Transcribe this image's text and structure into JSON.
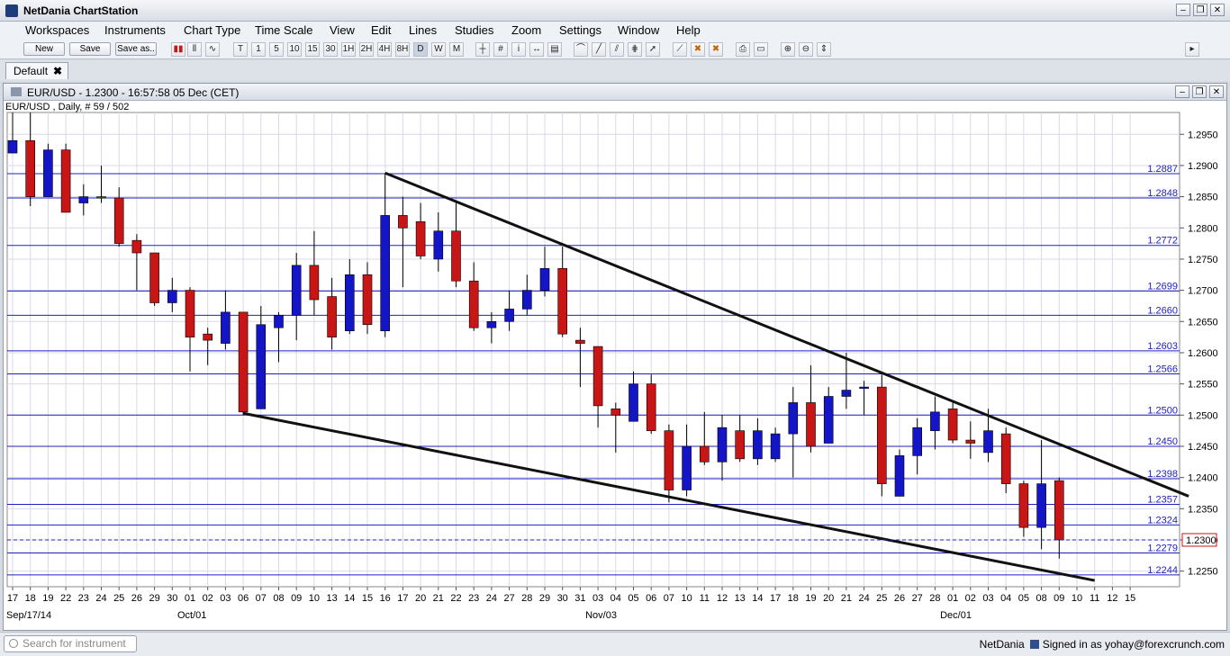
{
  "app": {
    "title": "NetDania ChartStation"
  },
  "menu": [
    "Workspaces",
    "Instruments",
    "Chart Type",
    "Time Scale",
    "View",
    "Edit",
    "Lines",
    "Studies",
    "Zoom",
    "Settings",
    "Window",
    "Help"
  ],
  "toolbar": {
    "new_label": "New",
    "save_label": "Save",
    "save_as_label": "Save as..",
    "timeframes": [
      "T",
      "1",
      "5",
      "10",
      "15",
      "30",
      "1H",
      "2H",
      "4H",
      "8H",
      "D",
      "W",
      "M"
    ]
  },
  "tabs": [
    {
      "label": "Default",
      "close": "✖"
    }
  ],
  "chart_window": {
    "title": "EUR/USD - 1.2300 - 16:57:58  05 Dec (CET)",
    "subtitle": "EUR/USD , Daily, # 59 / 502"
  },
  "statusbar": {
    "search_placeholder": "Search for instrument",
    "brand": "NetDania",
    "signed_in": "Signed in as yohay@forexcrunch.com"
  },
  "colors": {
    "up": "#1515c8",
    "down": "#c81515",
    "level": "#2020c0",
    "trend": "#111111",
    "grid": "#d8d8e8"
  },
  "chart_data": {
    "type": "candlestick",
    "symbol": "EUR/USD",
    "ylim": [
      1.2225,
      1.2985
    ],
    "yticks": [
      "1.2950",
      "1.2900",
      "1.2850",
      "1.2800",
      "1.2750",
      "1.2700",
      "1.2650",
      "1.2600",
      "1.2550",
      "1.2500",
      "1.2450",
      "1.2400",
      "1.2350",
      "1.2300",
      "1.2250"
    ],
    "dates": [
      "17",
      "18",
      "19",
      "22",
      "23",
      "24",
      "25",
      "26",
      "29",
      "30",
      "01",
      "02",
      "03",
      "06",
      "07",
      "08",
      "09",
      "10",
      "13",
      "14",
      "15",
      "16",
      "17",
      "20",
      "21",
      "22",
      "23",
      "24",
      "27",
      "28",
      "29",
      "30",
      "31",
      "03",
      "04",
      "05",
      "06",
      "07",
      "10",
      "11",
      "12",
      "13",
      "14",
      "17",
      "18",
      "19",
      "20",
      "21",
      "24",
      "25",
      "26",
      "27",
      "28",
      "01",
      "02",
      "03",
      "04",
      "05"
    ],
    "x_tick_labels": [
      "17",
      "18",
      "19",
      "22",
      "23",
      "24",
      "25",
      "26",
      "29",
      "30",
      "01",
      "02",
      "03",
      "06",
      "07",
      "08",
      "09",
      "10",
      "13",
      "14",
      "15",
      "16",
      "17",
      "20",
      "21",
      "22",
      "23",
      "24",
      "27",
      "28",
      "29",
      "30",
      "31",
      "03",
      "04",
      "05",
      "06",
      "07",
      "10",
      "11",
      "12",
      "13",
      "14",
      "17",
      "18",
      "19",
      "20",
      "21",
      "24",
      "25",
      "26",
      "27",
      "28",
      "01",
      "02",
      "03",
      "04",
      "05",
      "08",
      "09",
      "10",
      "11",
      "12",
      "15"
    ],
    "month_labels": [
      {
        "text": "Sep/17/14",
        "index": 0
      },
      {
        "text": "Oct/01",
        "index": 10
      },
      {
        "text": "Nov/03",
        "index": 33
      },
      {
        "text": "Dec/01",
        "index": 53
      }
    ],
    "ohlc": [
      [
        1.292,
        1.2985,
        1.292,
        1.294
      ],
      [
        1.294,
        1.2985,
        1.2835,
        1.285
      ],
      [
        1.285,
        1.2935,
        1.285,
        1.2925
      ],
      [
        1.2925,
        1.2935,
        1.2825,
        1.2825
      ],
      [
        1.284,
        1.287,
        1.282,
        1.285
      ],
      [
        1.285,
        1.29,
        1.284,
        1.2848
      ],
      [
        1.2848,
        1.2865,
        1.277,
        1.2775
      ],
      [
        1.278,
        1.279,
        1.27,
        1.276
      ],
      [
        1.276,
        1.276,
        1.2675,
        1.268
      ],
      [
        1.268,
        1.272,
        1.2665,
        1.27
      ],
      [
        1.27,
        1.2705,
        1.257,
        1.2625
      ],
      [
        1.263,
        1.264,
        1.258,
        1.262
      ],
      [
        1.2615,
        1.27,
        1.2605,
        1.2665
      ],
      [
        1.2665,
        1.2665,
        1.25,
        1.2505
      ],
      [
        1.251,
        1.2675,
        1.251,
        1.2645
      ],
      [
        1.264,
        1.2665,
        1.2585,
        1.266
      ],
      [
        1.266,
        1.276,
        1.262,
        1.274
      ],
      [
        1.274,
        1.2795,
        1.266,
        1.2685
      ],
      [
        1.269,
        1.272,
        1.2605,
        1.2625
      ],
      [
        1.2635,
        1.275,
        1.263,
        1.2725
      ],
      [
        1.2725,
        1.2745,
        1.263,
        1.2645
      ],
      [
        1.2635,
        1.2888,
        1.2625,
        1.282
      ],
      [
        1.282,
        1.285,
        1.2705,
        1.28
      ],
      [
        1.281,
        1.284,
        1.275,
        1.2755
      ],
      [
        1.275,
        1.2825,
        1.273,
        1.2795
      ],
      [
        1.2795,
        1.284,
        1.2705,
        1.2715
      ],
      [
        1.2715,
        1.2745,
        1.2635,
        1.264
      ],
      [
        1.264,
        1.2665,
        1.2615,
        1.265
      ],
      [
        1.265,
        1.27,
        1.2635,
        1.267
      ],
      [
        1.267,
        1.2725,
        1.266,
        1.27
      ],
      [
        1.27,
        1.277,
        1.269,
        1.2735
      ],
      [
        1.2735,
        1.277,
        1.2625,
        1.263
      ],
      [
        1.262,
        1.264,
        1.2545,
        1.2615
      ],
      [
        1.261,
        1.261,
        1.248,
        1.2515
      ],
      [
        1.251,
        1.252,
        1.244,
        1.25
      ],
      [
        1.249,
        1.257,
        1.249,
        1.255
      ],
      [
        1.255,
        1.2565,
        1.247,
        1.2475
      ],
      [
        1.2475,
        1.2485,
        1.236,
        1.238
      ],
      [
        1.238,
        1.2485,
        1.237,
        1.245
      ],
      [
        1.245,
        1.2505,
        1.242,
        1.2425
      ],
      [
        1.2425,
        1.25,
        1.2395,
        1.248
      ],
      [
        1.2475,
        1.25,
        1.2425,
        1.243
      ],
      [
        1.243,
        1.2495,
        1.242,
        1.2475
      ],
      [
        1.243,
        1.248,
        1.2425,
        1.247
      ],
      [
        1.247,
        1.2545,
        1.24,
        1.252
      ],
      [
        1.252,
        1.258,
        1.244,
        1.245
      ],
      [
        1.2455,
        1.2545,
        1.2455,
        1.253
      ],
      [
        1.253,
        1.26,
        1.251,
        1.254
      ],
      [
        1.2545,
        1.2555,
        1.25,
        1.2545
      ],
      [
        1.2545,
        1.2565,
        1.237,
        1.239
      ],
      [
        1.237,
        1.2445,
        1.237,
        1.2435
      ],
      [
        1.2435,
        1.2495,
        1.2405,
        1.248
      ],
      [
        1.2475,
        1.253,
        1.2445,
        1.2505
      ],
      [
        1.251,
        1.252,
        1.2455,
        1.246
      ],
      [
        1.246,
        1.249,
        1.243,
        1.2455
      ],
      [
        1.244,
        1.251,
        1.2425,
        1.2475
      ],
      [
        1.247,
        1.248,
        1.2375,
        1.239
      ],
      [
        1.239,
        1.2395,
        1.2305,
        1.232
      ],
      [
        1.232,
        1.246,
        1.2285,
        1.239
      ],
      [
        1.2395,
        1.24,
        1.227,
        1.23
      ]
    ],
    "horizontal_levels": [
      "1.2887",
      "1.2848",
      "1.2772",
      "1.2699",
      "1.2660",
      "1.2603",
      "1.2566",
      "1.2500",
      "1.2450",
      "1.2398",
      "1.2357",
      "1.2324",
      "1.2279",
      "1.2244"
    ],
    "current_price": "1.2300",
    "trendlines": [
      {
        "from": {
          "index": 21,
          "price": 1.2888
        },
        "to": {
          "index": 66.3,
          "price": 1.237
        }
      },
      {
        "from": {
          "index": 13,
          "price": 1.2503
        },
        "to": {
          "index": 61,
          "price": 1.2235
        }
      }
    ],
    "grid": true
  }
}
